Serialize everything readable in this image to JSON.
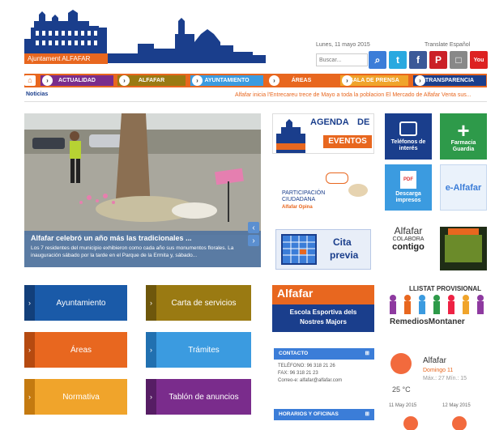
{
  "header": {
    "logo_text": "Ajuntament ALFAFAR",
    "date": "Lunes, 11 mayo 2015",
    "translate": "Translate  Español",
    "search_placeholder": "Buscar..."
  },
  "colors": {
    "blue": "#1a3e8c",
    "orange": "#e8671f",
    "twitter": "#2aa9e0",
    "facebook": "#3b5998",
    "pinterest": "#cb2027",
    "purple": "#7a2c8c",
    "gold": "#9a7a12",
    "lightblue": "#3b9be0",
    "green": "#2e9a4a"
  },
  "nav": [
    {
      "label": "Actualidad"
    },
    {
      "label": "Alfafar"
    },
    {
      "label": "Ayuntamiento"
    },
    {
      "label": "Áreas"
    },
    {
      "label": "Sala de prensa"
    },
    {
      "label": "Transparencia"
    }
  ],
  "ticker": {
    "label": "Noticias",
    "text": "Alfafar inicia l'Entrecareu trece de Mayo a toda la poblacion   El Mercado de Alfafar Venta sus..."
  },
  "slider": {
    "title": "Alfafar celebró un año más las tradicionales ...",
    "desc": "Los 7 residentes del municipio exhibieron como cada año sus monumentos florales. La inauguración sábado por la tarde en el Parque de la Ermita y, sábado..."
  },
  "banners": {
    "agenda_line1": "AGENDA",
    "agenda_line2": "DE",
    "agenda_line3": "EVENTOS",
    "participacion": "PARTICIPACIÓN CIUDADANA",
    "participacion_sub": "Alfafar Opina",
    "cita_line1": "Cita",
    "cita_line2": "previa",
    "alfafar_colabora": "Alfafar",
    "colabora": "COLABORA",
    "contigo": "contigo",
    "escola_title": "Alfafar",
    "escola_line1": "Escola Esportiva dels",
    "escola_line2": "Nostres Majors",
    "lista_provisional": "LLISTAT PROVISIONAL",
    "remedios": "RemediosMontaner"
  },
  "tiles": {
    "telefonos": "Teléfonos de interés",
    "farmacia": "Farmacia Guardia",
    "descarga": "Descarga impresos",
    "ealfafar": "e-Alfafar"
  },
  "buttons": {
    "ayuntamiento": "Ayuntamiento",
    "carta": "Carta de servicios",
    "areas": "Áreas",
    "tramites": "Trámites",
    "normativa": "Normativa",
    "tablon": "Tablón de anuncios"
  },
  "contacto": {
    "title": "CONTACTO",
    "telefono": "TELÉFONO: 96 318 21 26",
    "fax": "FAX: 96 318 21 23",
    "correo": "Correo-e: alfafar@alfafar.com",
    "horarios": "HORARIOS Y OFICINAS"
  },
  "weather": {
    "city": "Alfafar",
    "day": "Domingo 11",
    "hours": "Máx.: 27 Mín.: 15",
    "temp": "25 °C",
    "d1": "11 May 2015",
    "d2": "12 May 2015"
  }
}
